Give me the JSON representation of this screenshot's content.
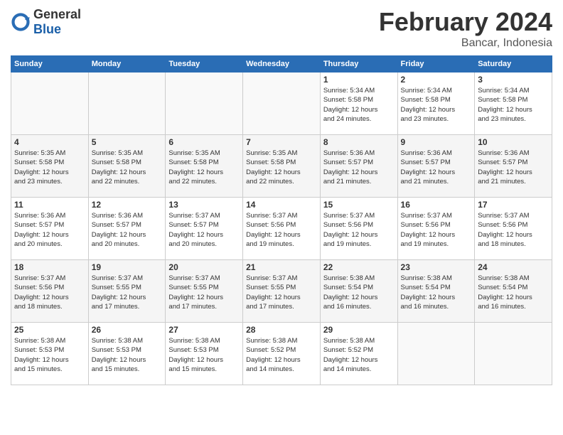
{
  "app": {
    "name_general": "General",
    "name_blue": "Blue"
  },
  "header": {
    "month": "February 2024",
    "location": "Bancar, Indonesia"
  },
  "days_of_week": [
    "Sunday",
    "Monday",
    "Tuesday",
    "Wednesday",
    "Thursday",
    "Friday",
    "Saturday"
  ],
  "weeks": [
    [
      {
        "day": "",
        "info": ""
      },
      {
        "day": "",
        "info": ""
      },
      {
        "day": "",
        "info": ""
      },
      {
        "day": "",
        "info": ""
      },
      {
        "day": "1",
        "info": "Sunrise: 5:34 AM\nSunset: 5:58 PM\nDaylight: 12 hours\nand 24 minutes."
      },
      {
        "day": "2",
        "info": "Sunrise: 5:34 AM\nSunset: 5:58 PM\nDaylight: 12 hours\nand 23 minutes."
      },
      {
        "day": "3",
        "info": "Sunrise: 5:34 AM\nSunset: 5:58 PM\nDaylight: 12 hours\nand 23 minutes."
      }
    ],
    [
      {
        "day": "4",
        "info": "Sunrise: 5:35 AM\nSunset: 5:58 PM\nDaylight: 12 hours\nand 23 minutes."
      },
      {
        "day": "5",
        "info": "Sunrise: 5:35 AM\nSunset: 5:58 PM\nDaylight: 12 hours\nand 22 minutes."
      },
      {
        "day": "6",
        "info": "Sunrise: 5:35 AM\nSunset: 5:58 PM\nDaylight: 12 hours\nand 22 minutes."
      },
      {
        "day": "7",
        "info": "Sunrise: 5:35 AM\nSunset: 5:58 PM\nDaylight: 12 hours\nand 22 minutes."
      },
      {
        "day": "8",
        "info": "Sunrise: 5:36 AM\nSunset: 5:57 PM\nDaylight: 12 hours\nand 21 minutes."
      },
      {
        "day": "9",
        "info": "Sunrise: 5:36 AM\nSunset: 5:57 PM\nDaylight: 12 hours\nand 21 minutes."
      },
      {
        "day": "10",
        "info": "Sunrise: 5:36 AM\nSunset: 5:57 PM\nDaylight: 12 hours\nand 21 minutes."
      }
    ],
    [
      {
        "day": "11",
        "info": "Sunrise: 5:36 AM\nSunset: 5:57 PM\nDaylight: 12 hours\nand 20 minutes."
      },
      {
        "day": "12",
        "info": "Sunrise: 5:36 AM\nSunset: 5:57 PM\nDaylight: 12 hours\nand 20 minutes."
      },
      {
        "day": "13",
        "info": "Sunrise: 5:37 AM\nSunset: 5:57 PM\nDaylight: 12 hours\nand 20 minutes."
      },
      {
        "day": "14",
        "info": "Sunrise: 5:37 AM\nSunset: 5:56 PM\nDaylight: 12 hours\nand 19 minutes."
      },
      {
        "day": "15",
        "info": "Sunrise: 5:37 AM\nSunset: 5:56 PM\nDaylight: 12 hours\nand 19 minutes."
      },
      {
        "day": "16",
        "info": "Sunrise: 5:37 AM\nSunset: 5:56 PM\nDaylight: 12 hours\nand 19 minutes."
      },
      {
        "day": "17",
        "info": "Sunrise: 5:37 AM\nSunset: 5:56 PM\nDaylight: 12 hours\nand 18 minutes."
      }
    ],
    [
      {
        "day": "18",
        "info": "Sunrise: 5:37 AM\nSunset: 5:56 PM\nDaylight: 12 hours\nand 18 minutes."
      },
      {
        "day": "19",
        "info": "Sunrise: 5:37 AM\nSunset: 5:55 PM\nDaylight: 12 hours\nand 17 minutes."
      },
      {
        "day": "20",
        "info": "Sunrise: 5:37 AM\nSunset: 5:55 PM\nDaylight: 12 hours\nand 17 minutes."
      },
      {
        "day": "21",
        "info": "Sunrise: 5:37 AM\nSunset: 5:55 PM\nDaylight: 12 hours\nand 17 minutes."
      },
      {
        "day": "22",
        "info": "Sunrise: 5:38 AM\nSunset: 5:54 PM\nDaylight: 12 hours\nand 16 minutes."
      },
      {
        "day": "23",
        "info": "Sunrise: 5:38 AM\nSunset: 5:54 PM\nDaylight: 12 hours\nand 16 minutes."
      },
      {
        "day": "24",
        "info": "Sunrise: 5:38 AM\nSunset: 5:54 PM\nDaylight: 12 hours\nand 16 minutes."
      }
    ],
    [
      {
        "day": "25",
        "info": "Sunrise: 5:38 AM\nSunset: 5:53 PM\nDaylight: 12 hours\nand 15 minutes."
      },
      {
        "day": "26",
        "info": "Sunrise: 5:38 AM\nSunset: 5:53 PM\nDaylight: 12 hours\nand 15 minutes."
      },
      {
        "day": "27",
        "info": "Sunrise: 5:38 AM\nSunset: 5:53 PM\nDaylight: 12 hours\nand 15 minutes."
      },
      {
        "day": "28",
        "info": "Sunrise: 5:38 AM\nSunset: 5:52 PM\nDaylight: 12 hours\nand 14 minutes."
      },
      {
        "day": "29",
        "info": "Sunrise: 5:38 AM\nSunset: 5:52 PM\nDaylight: 12 hours\nand 14 minutes."
      },
      {
        "day": "",
        "info": ""
      },
      {
        "day": "",
        "info": ""
      }
    ]
  ]
}
